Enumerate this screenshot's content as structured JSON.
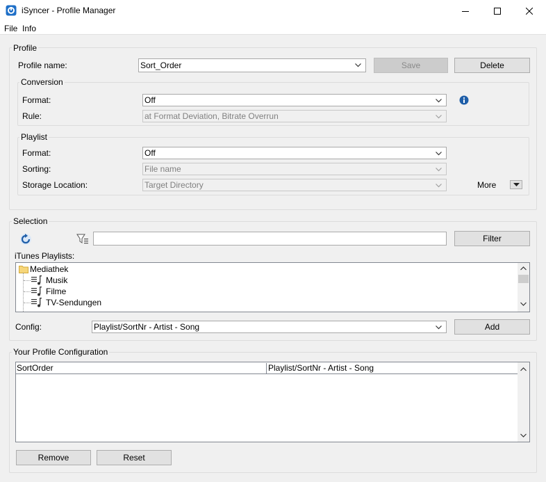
{
  "window": {
    "title": "iSyncer - Profile Manager",
    "accent": "#1e6fc7"
  },
  "menu": {
    "file": "File",
    "info": "Info"
  },
  "profile": {
    "group_label": "Profile",
    "name_label": "Profile name:",
    "name_value": "Sort_Order",
    "save_label": "Save",
    "delete_label": "Delete",
    "conversion": {
      "group_label": "Conversion",
      "format_label": "Format:",
      "format_value": "Off",
      "rule_label": "Rule:",
      "rule_value": "at Format Deviation, Bitrate Overrun"
    },
    "playlist": {
      "group_label": "Playlist",
      "format_label": "Format:",
      "format_value": "Off",
      "sorting_label": "Sorting:",
      "sorting_value": "File name",
      "storage_label": "Storage Location:",
      "storage_value": "Target Directory",
      "more_label": "More"
    }
  },
  "selection": {
    "group_label": "Selection",
    "filter_value": "",
    "filter_button": "Filter",
    "playlists_label": "iTunes Playlists:",
    "tree": {
      "root": "Mediathek",
      "children": [
        "Musik",
        "Filme",
        "TV-Sendungen"
      ]
    },
    "config_label": "Config:",
    "config_value": "Playlist/SortNr - Artist - Song",
    "add_button": "Add"
  },
  "your_config": {
    "group_label": "Your Profile Configuration",
    "rows": [
      {
        "name": "SortOrder",
        "config": "Playlist/SortNr - Artist - Song"
      }
    ],
    "remove_button": "Remove",
    "reset_button": "Reset"
  }
}
